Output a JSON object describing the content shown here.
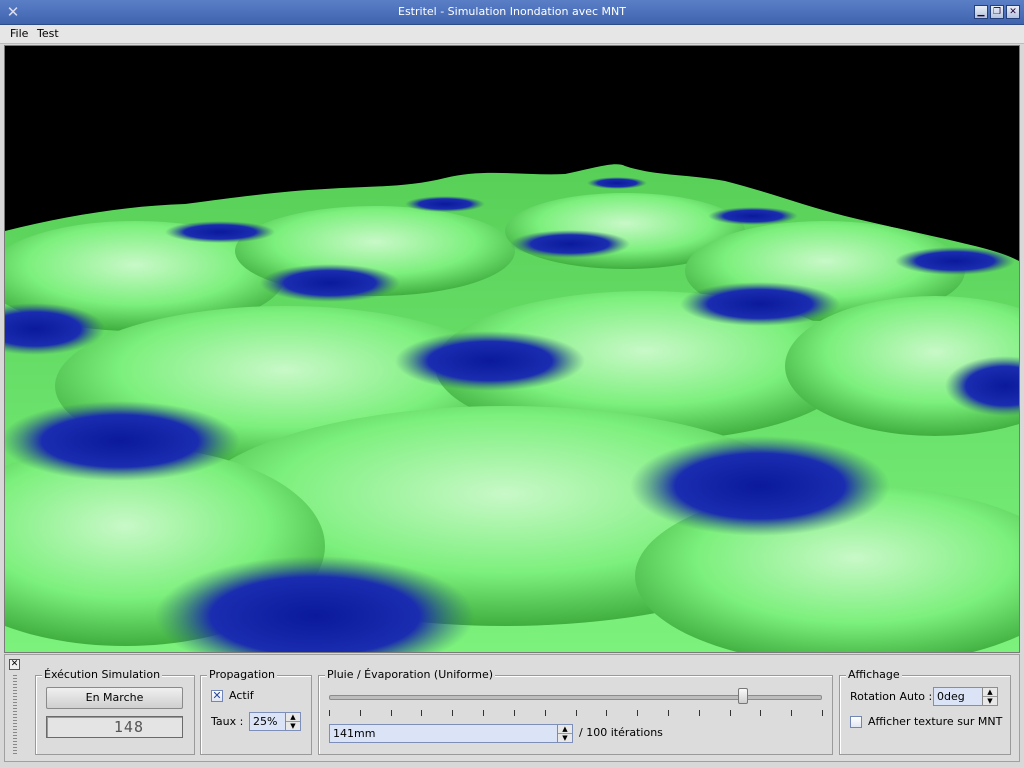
{
  "window": {
    "title": "Estritel - Simulation Inondation avec MNT"
  },
  "menu": {
    "file": "File",
    "test": "Test"
  },
  "dock": {
    "execution": {
      "title": "Éxécution Simulation",
      "run_button": "En Marche",
      "counter": "148"
    },
    "propagation": {
      "title": "Propagation",
      "actif_label": "Actif",
      "actif_checked": true,
      "taux_label": "Taux :",
      "taux_value": "25%"
    },
    "pluie": {
      "title": "Pluie / Évaporation (Uniforme)",
      "slider_fraction": 0.84,
      "tick_count": 17,
      "amount_value": "141mm",
      "iterations_label": "/ 100 itérations"
    },
    "affichage": {
      "title": "Affichage",
      "rotation_label": "Rotation Auto :",
      "rotation_value": "0deg",
      "texture_label": "Afficher texture sur MNT",
      "texture_checked": false
    }
  },
  "colors": {
    "land": "#6ef06e",
    "water": "#1a24a8",
    "sky": "#000000",
    "titlebar": "#4a6fbb"
  }
}
